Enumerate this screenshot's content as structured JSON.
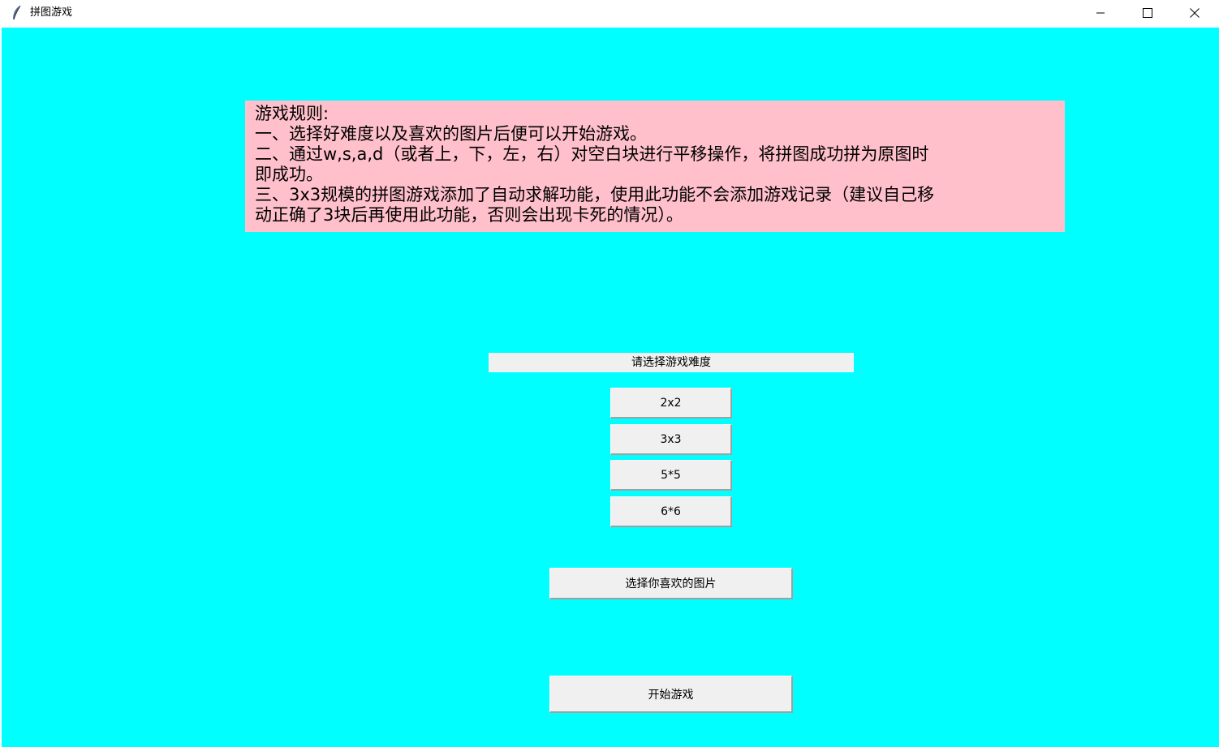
{
  "window": {
    "title": "拼图游戏",
    "app_icon": "feather-icon",
    "controls": [
      "minimize-icon",
      "maximize-icon",
      "close-icon"
    ]
  },
  "rules": {
    "lines": [
      "游戏规则:",
      "一、选择好难度以及喜欢的图片后便可以开始游戏。",
      "二、通过w,s,a,d（或者上，下，左，右）对空白块进行平移操作，将拼图成功拼为原图时",
      "即成功。",
      "三、3x3规模的拼图游戏添加了自动求解功能，使用此功能不会添加游戏记录（建议自己移",
      "动正确了3块后再使用此功能，否则会出现卡死的情况）。"
    ]
  },
  "difficulty": {
    "label": "请选择游戏难度",
    "options": [
      "2x2",
      "3x3",
      "5*5",
      "6*6"
    ]
  },
  "buttons": {
    "pick_image": "选择你喜欢的图片",
    "start": "开始游戏"
  },
  "colors": {
    "background": "#00ffff",
    "rules_background": "#ffc0cb",
    "button_face": "#f0f0f0"
  }
}
